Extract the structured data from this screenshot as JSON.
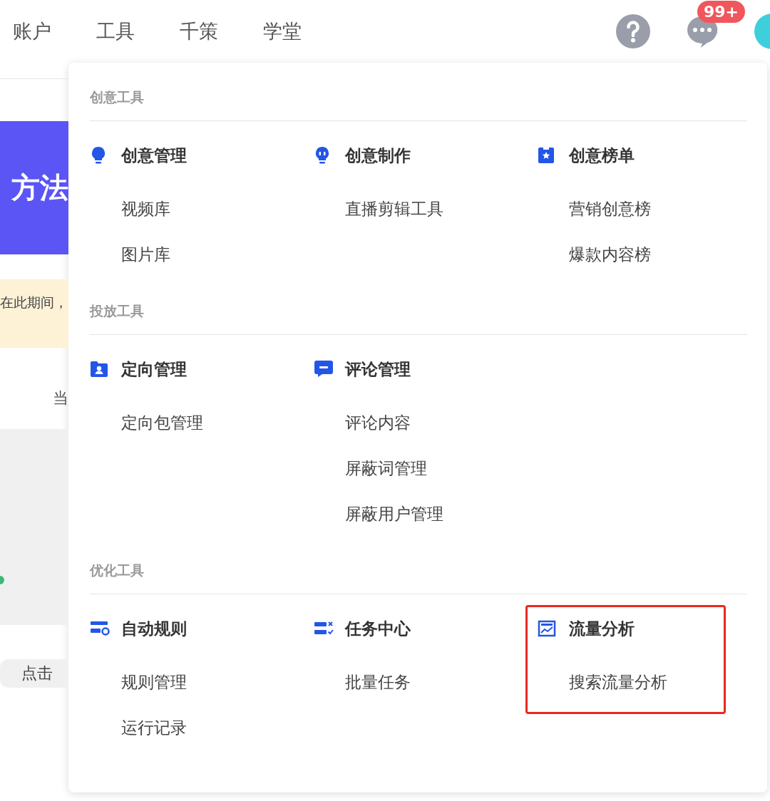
{
  "nav": {
    "items": [
      "账户",
      "工具",
      "千策",
      "学堂"
    ]
  },
  "header": {
    "badge": "99+"
  },
  "background": {
    "banner_text": "方法",
    "notice_text": "在此期间，",
    "label": "当",
    "pill_text": "点击"
  },
  "menu": {
    "sections": [
      {
        "title": "创意工具",
        "groups": [
          {
            "title": "创意管理",
            "items": [
              "视频库",
              "图片库"
            ],
            "highlighted": false
          },
          {
            "title": "创意制作",
            "items": [
              "直播剪辑工具"
            ],
            "highlighted": false
          },
          {
            "title": "创意榜单",
            "items": [
              "营销创意榜",
              "爆款内容榜"
            ],
            "highlighted": false
          }
        ]
      },
      {
        "title": "投放工具",
        "groups": [
          {
            "title": "定向管理",
            "items": [
              "定向包管理"
            ],
            "highlighted": false
          },
          {
            "title": "评论管理",
            "items": [
              "评论内容",
              "屏蔽词管理",
              "屏蔽用户管理"
            ],
            "highlighted": false
          }
        ]
      },
      {
        "title": "优化工具",
        "groups": [
          {
            "title": "自动规则",
            "items": [
              "规则管理",
              "运行记录"
            ],
            "highlighted": false
          },
          {
            "title": "任务中心",
            "items": [
              "批量任务"
            ],
            "highlighted": false
          },
          {
            "title": "流量分析",
            "items": [
              "搜索流量分析"
            ],
            "highlighted": true
          }
        ]
      }
    ]
  }
}
